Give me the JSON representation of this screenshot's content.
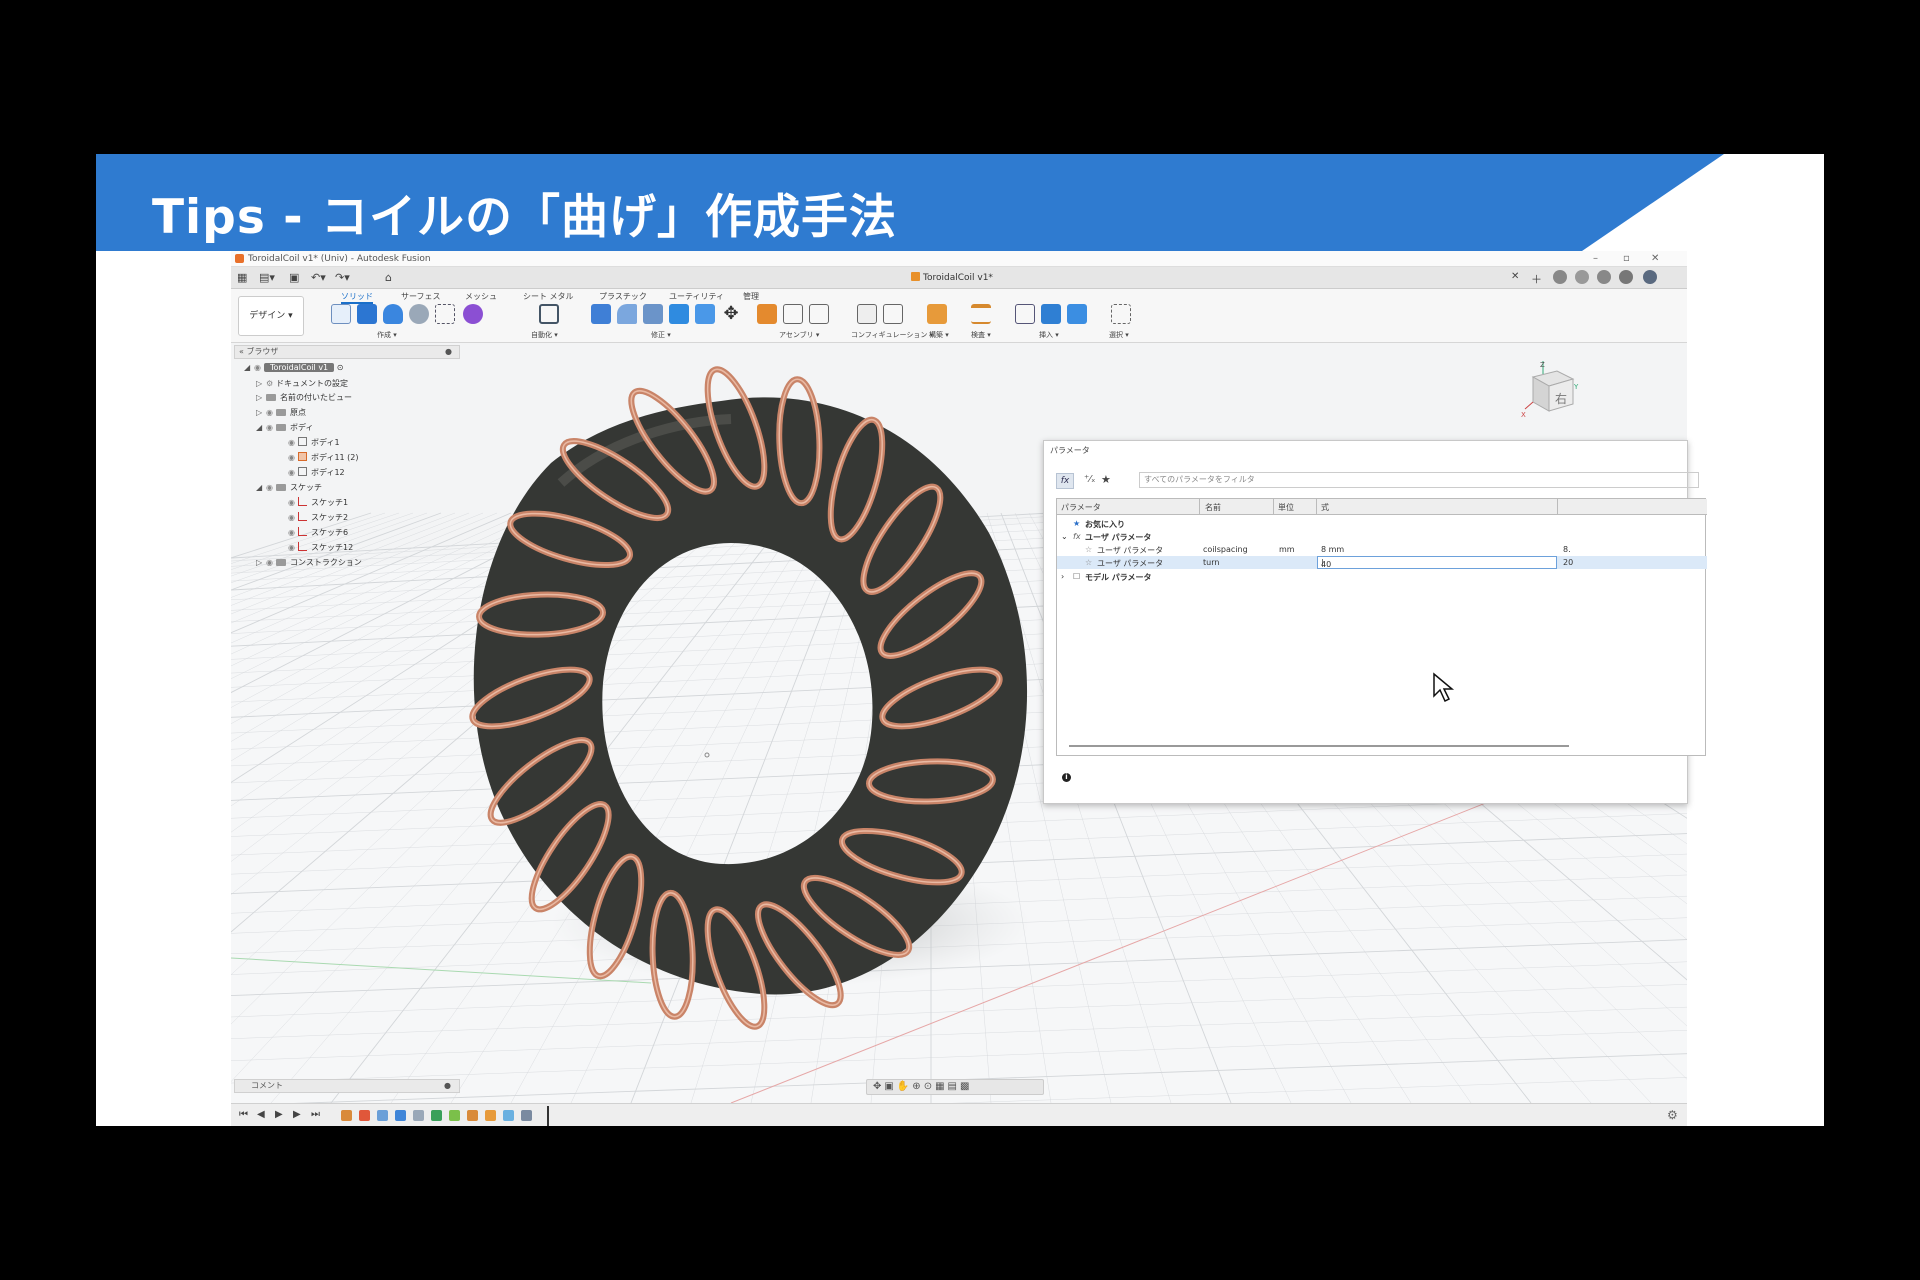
{
  "slide": {
    "title": "Tips - コイルの「曲げ」作成手法",
    "banner_color": "#2f7bd0"
  },
  "app": {
    "window_title": "ToroidalCoil v1* (Univ) - Autodesk Fusion",
    "doc_tab": "ToroidalCoil v1*",
    "workspace_button": "デザイン ▾",
    "ribbon_tabs": [
      "ソリッド",
      "サーフェス",
      "メッシュ",
      "シート メタル",
      "プラスチック",
      "ユーティリティ",
      "管理"
    ],
    "ribbon_groups": [
      "作成 ▾",
      "自動化 ▾",
      "修正 ▾",
      "アセンブリ ▾",
      "コンフィギュレーション ▾",
      "構築 ▾",
      "検査 ▾",
      "挿入 ▾",
      "選択 ▾"
    ],
    "accent_color": "#1a6fc9"
  },
  "browser": {
    "header": "ブラウザ",
    "root": "ToroidalCoil v1",
    "items": [
      "ドキュメントの設定",
      "名前の付いたビュー",
      "原点",
      "ボディ",
      "ボディ1",
      "ボディ11 (2)",
      "ボディ12",
      "スケッチ",
      "スケッチ1",
      "スケッチ2",
      "スケッチ6",
      "スケッチ12",
      "コンストラクション"
    ]
  },
  "viewcube": {
    "face_label": "右",
    "axis_z": "Z",
    "axis_x": "X",
    "axis_y": "Y"
  },
  "parameters_dialog": {
    "title": "パラメータ",
    "filter_placeholder": "すべてのパラメータをフィルタ",
    "columns": [
      "パラメータ",
      "名前",
      "単位",
      "式"
    ],
    "favorites_label": "お気に入り",
    "user_params_label": "ユーザ パラメータ",
    "model_params_label": "モデル パラメータ",
    "rows": [
      {
        "param": "ユーザ パラメータ",
        "name": "coilspacing",
        "unit": "mm",
        "expr": "8 mm",
        "value": "8."
      },
      {
        "param": "ユーザ パラメータ",
        "name": "turn",
        "unit": "",
        "expr": "40",
        "value": "20"
      }
    ]
  },
  "comments": {
    "label": "コメント"
  },
  "colors": {
    "torus": "#3d3f3c",
    "copper": "#c98468",
    "grid_bg": "#f3f4f5"
  }
}
